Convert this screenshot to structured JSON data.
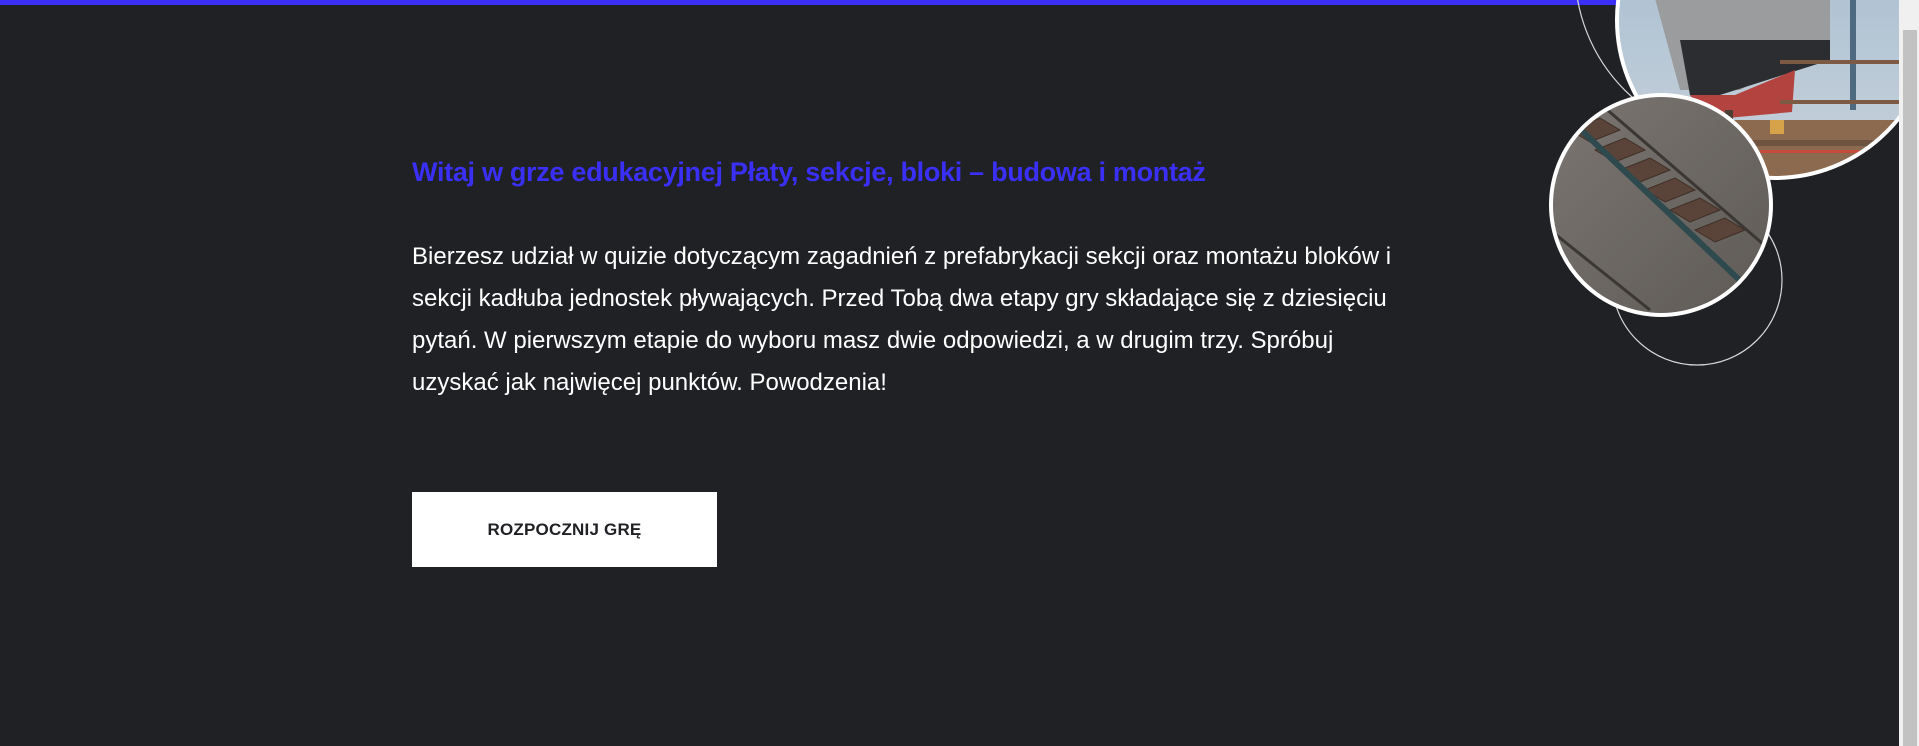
{
  "welcome": {
    "title": "Witaj w grze edukacyjnej Płaty, sekcje, bloki – budowa i montaż",
    "paragraph": "Bierzesz udział w quizie dotyczącym zagadnień z prefabrykacji sekcji oraz montażu bloków i sekcji kadłuba jednostek pływających. Przed Tobą dwa etapy gry składające się z dziesięciu pytań. W pierwszym etapie do wyboru masz dwie odpowiedzi, a w drugim trzy. Spróbuj uzyskać jak najwięcej punktów. Powodzenia!",
    "start_button": "ROZPOCZNIJ GRĘ"
  },
  "colors": {
    "background": "#202125",
    "accent": "#3a2ff5",
    "text": "#ffffff"
  }
}
